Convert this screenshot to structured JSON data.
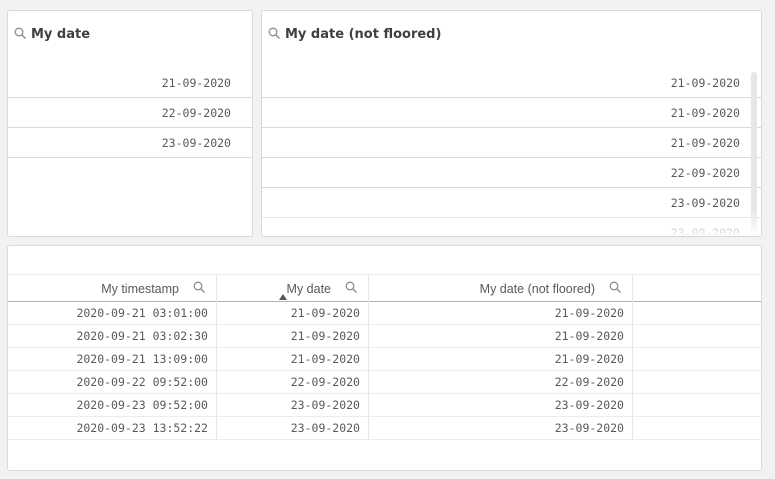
{
  "filter1": {
    "title": "My date",
    "items": [
      "21-09-2020",
      "22-09-2020",
      "23-09-2020"
    ]
  },
  "filter2": {
    "title": "My date (not floored)",
    "items": [
      "21-09-2020",
      "21-09-2020",
      "21-09-2020",
      "22-09-2020",
      "23-09-2020",
      "23-09-2020"
    ]
  },
  "table": {
    "columns": [
      "My timestamp",
      "My date",
      "My date (not floored)"
    ],
    "sorted_column": "My date",
    "rows": [
      [
        "2020-09-21 03:01:00",
        "21-09-2020",
        "21-09-2020"
      ],
      [
        "2020-09-21 03:02:30",
        "21-09-2020",
        "21-09-2020"
      ],
      [
        "2020-09-21 13:09:00",
        "21-09-2020",
        "21-09-2020"
      ],
      [
        "2020-09-22 09:52:00",
        "22-09-2020",
        "22-09-2020"
      ],
      [
        "2020-09-23 09:52:00",
        "23-09-2020",
        "23-09-2020"
      ],
      [
        "2020-09-23 13:52:22",
        "23-09-2020",
        "23-09-2020"
      ]
    ]
  },
  "colors": {
    "background": "#f2f2f2",
    "panel": "#ffffff",
    "border": "#d9d9d9",
    "text": "#595959"
  },
  "icons": {
    "search": "search-icon",
    "sort": "sort-ascending-icon"
  }
}
